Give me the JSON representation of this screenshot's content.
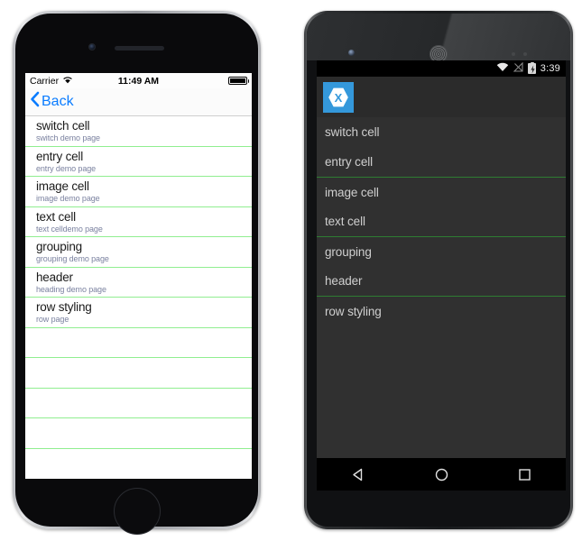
{
  "ios": {
    "status_bar": {
      "carrier": "Carrier",
      "wifi_icon": "wifi-icon",
      "time": "11:49 AM",
      "battery_icon": "battery-full-icon"
    },
    "nav_bar": {
      "back_label": "Back",
      "back_icon": "chevron-left-icon"
    },
    "list": {
      "rows": [
        {
          "title": "switch cell",
          "subtitle": "switch demo page"
        },
        {
          "title": "entry cell",
          "subtitle": "entry demo page"
        },
        {
          "title": "image cell",
          "subtitle": "image demo page"
        },
        {
          "title": "text cell",
          "subtitle": "text celldemo page"
        },
        {
          "title": "grouping",
          "subtitle": "grouping demo page"
        },
        {
          "title": "header",
          "subtitle": "heading demo page"
        },
        {
          "title": "row styling",
          "subtitle": "row page"
        }
      ],
      "empty_row_count": 4,
      "separator_color": "#90ee90"
    },
    "home_button_icon": "home-button-icon"
  },
  "android": {
    "status_bar": {
      "wifi_icon": "wifi-icon",
      "signal_icon": "signal-off-icon",
      "battery_icon": "battery-charging-icon",
      "time": "3:39"
    },
    "app_bar": {
      "logo_icon": "xamarin-logo-icon",
      "logo_bg_color": "#3498db"
    },
    "list": {
      "rows": [
        {
          "title": "switch cell",
          "separator_above": false
        },
        {
          "title": "entry cell",
          "separator_above": false
        },
        {
          "title": "image cell",
          "separator_above": true
        },
        {
          "title": "text cell",
          "separator_above": false
        },
        {
          "title": "grouping",
          "separator_above": true
        },
        {
          "title": "header",
          "separator_above": false
        },
        {
          "title": "row styling",
          "separator_above": true
        }
      ],
      "separator_color": "#2e7d32",
      "background_color": "#303030"
    },
    "nav_bar": {
      "back_icon": "back-triangle-icon",
      "home_icon": "home-circle-icon",
      "recents_icon": "recents-square-icon"
    }
  }
}
